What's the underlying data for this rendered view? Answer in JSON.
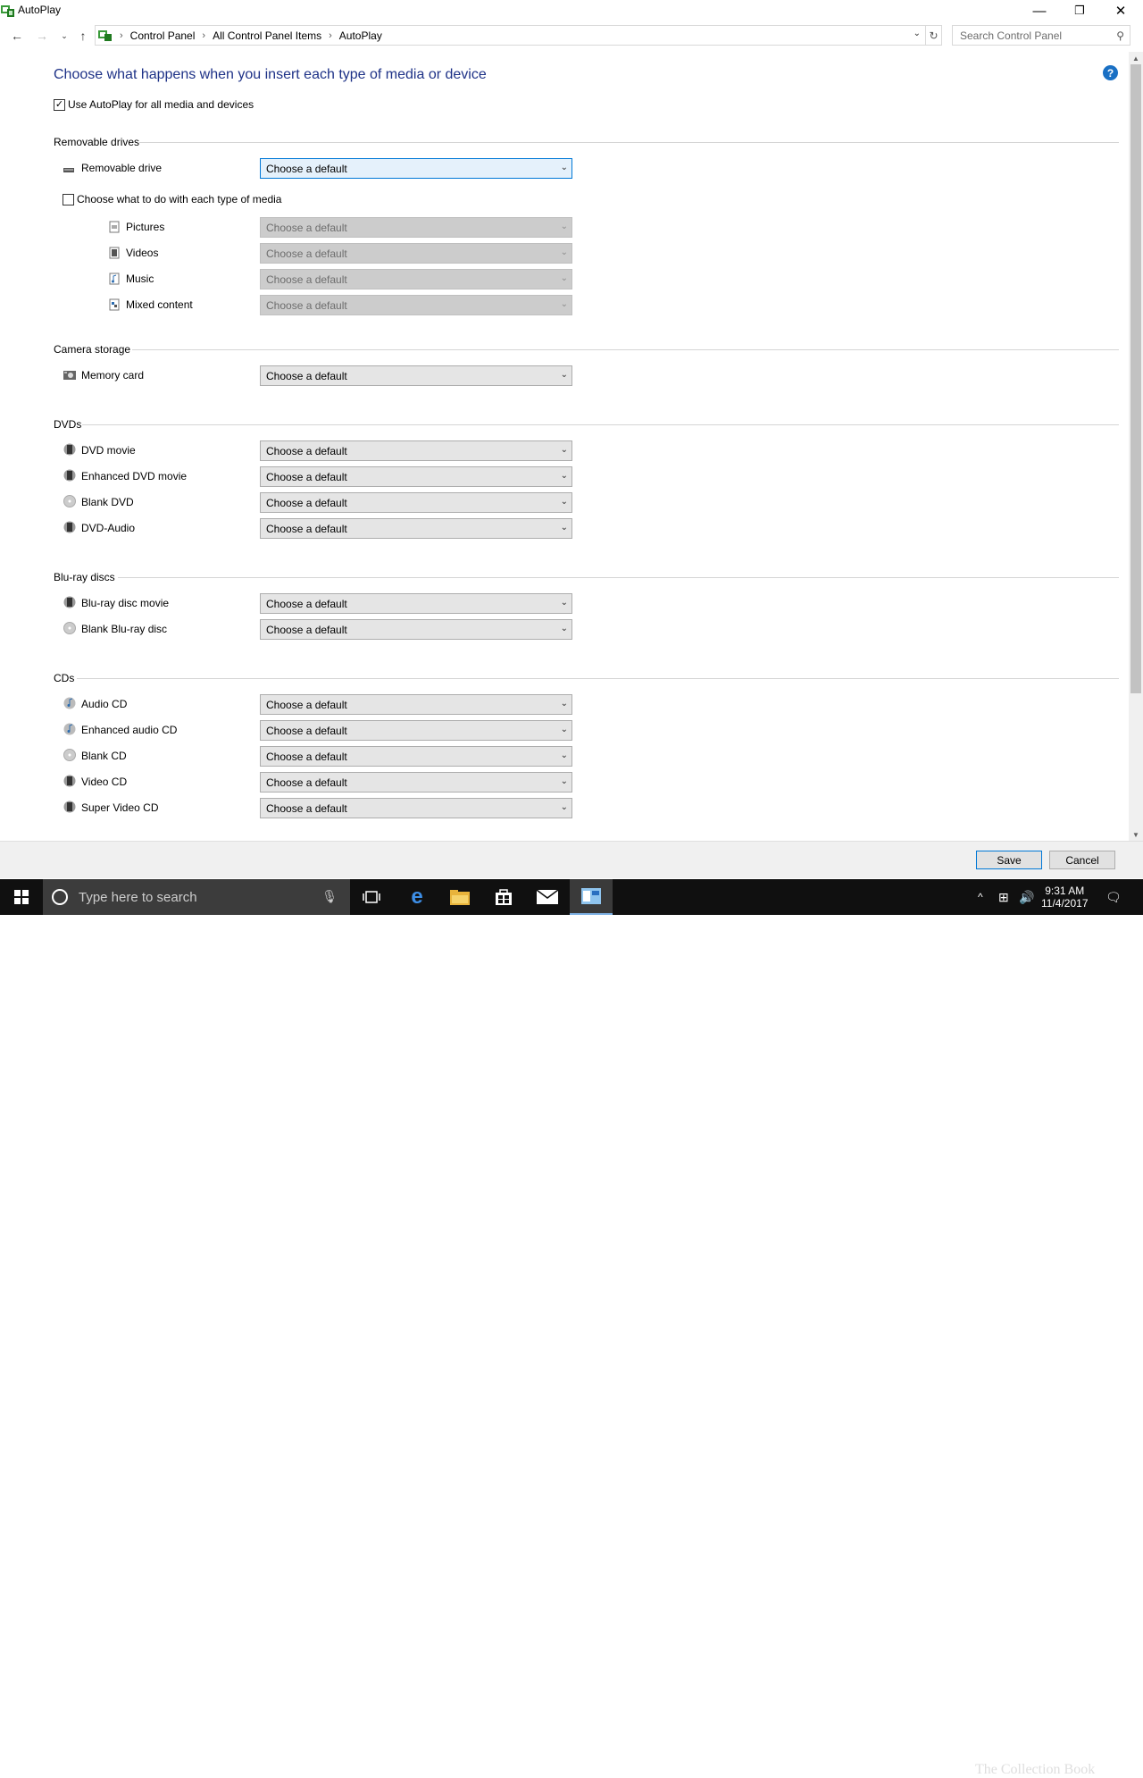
{
  "window": {
    "title": "AutoPlay",
    "minimize": "—",
    "maximize": "❐",
    "close": "✕"
  },
  "address": {
    "crumbs": [
      "Control Panel",
      "All Control Panel Items",
      "AutoPlay"
    ],
    "search_placeholder": "Search Control Panel"
  },
  "heading": "Choose what happens when you insert each type of media or device",
  "use_autoplay": {
    "label": "Use AutoPlay for all media and devices",
    "checked": true
  },
  "default_choice": "Choose a default",
  "removable": {
    "group": "Removable drives",
    "drive_label": "Removable drive",
    "each_media_label": "Choose what to do with each type of media",
    "media": [
      "Pictures",
      "Videos",
      "Music",
      "Mixed content"
    ]
  },
  "camera": {
    "group": "Camera storage",
    "items": [
      "Memory card"
    ]
  },
  "dvds": {
    "group": "DVDs",
    "items": [
      "DVD movie",
      "Enhanced DVD movie",
      "Blank DVD",
      "DVD-Audio"
    ]
  },
  "bluray": {
    "group": "Blu-ray discs",
    "items": [
      "Blu-ray disc movie",
      "Blank Blu-ray disc"
    ]
  },
  "cds": {
    "group": "CDs",
    "items": [
      "Audio CD",
      "Enhanced audio CD",
      "Blank CD",
      "Video CD",
      "Super Video CD"
    ]
  },
  "buttons": {
    "save": "Save",
    "cancel": "Cancel"
  },
  "taskbar": {
    "search_placeholder": "Type here to search",
    "time": "9:31 AM",
    "date": "11/4/2017",
    "watermark": "The Collection Book"
  },
  "colors": {
    "heading": "#1e3287",
    "accent": "#0078d7",
    "help": "#1a70c4"
  }
}
